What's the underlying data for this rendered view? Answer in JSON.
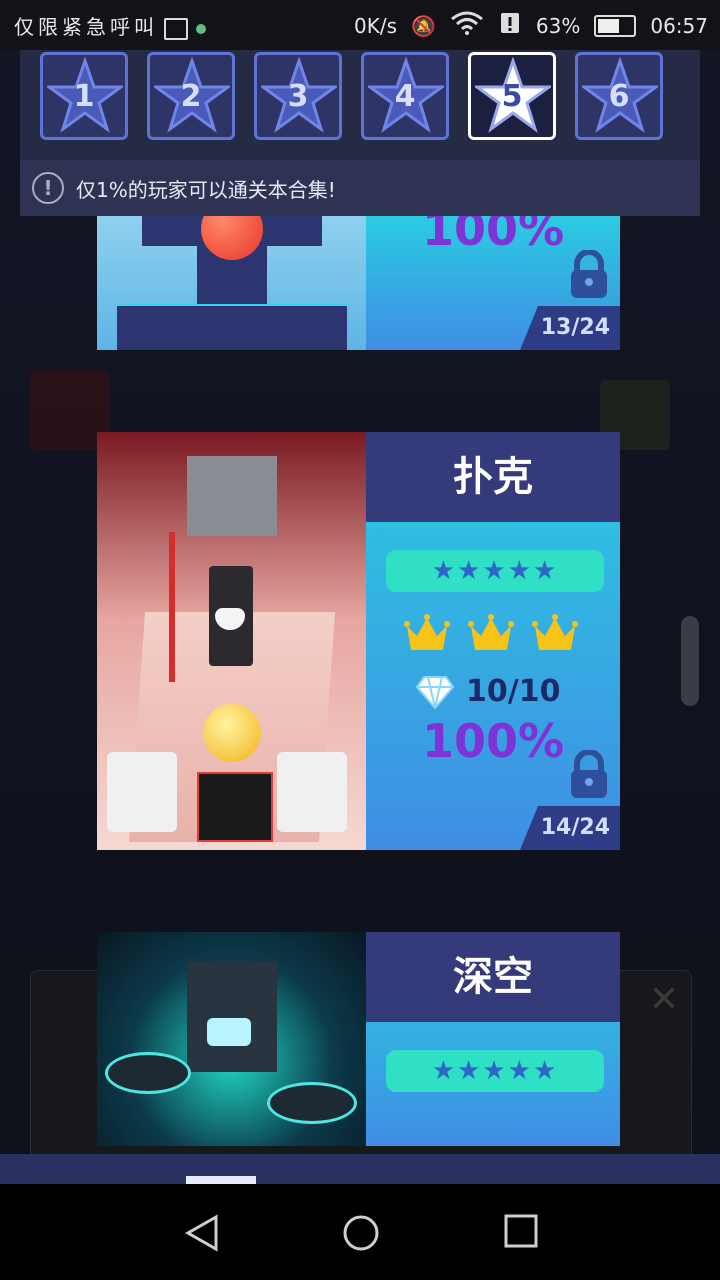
{
  "status_bar": {
    "left_text": "仅限紧急呼叫",
    "speed": "0K/s",
    "battery": "63%",
    "time": "06:57"
  },
  "level_tabs": [
    {
      "label": "1",
      "active": false
    },
    {
      "label": "2",
      "active": false
    },
    {
      "label": "3",
      "active": false
    },
    {
      "label": "4",
      "active": false
    },
    {
      "label": "5",
      "active": true
    },
    {
      "label": "6",
      "active": false
    }
  ],
  "notice": {
    "icon": "info-icon",
    "text": "仅1%的玩家可以通关本合集!"
  },
  "cards": [
    {
      "percent": "100%",
      "progress": "13/24"
    },
    {
      "title": "扑克",
      "stars": "★★★★★",
      "gems": "10/10",
      "percent": "100%",
      "progress": "14/24"
    },
    {
      "title": "深空",
      "stars": "★★★★★"
    }
  ],
  "colors": {
    "accent": "#5d74d6",
    "panel": "#252a45",
    "card_head": "#343a7a",
    "percent": "#7d33d6"
  }
}
